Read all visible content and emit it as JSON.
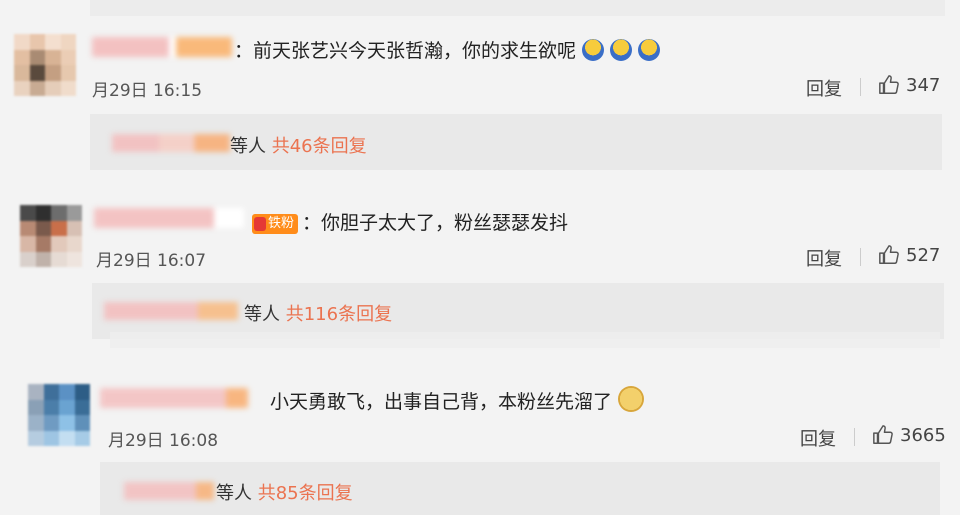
{
  "comments": [
    {
      "text": "：前天张艺兴今天张哲瀚，你的求生欲呢",
      "emoji": "sad-emoji-icon",
      "timestamp": "月29日 16:15",
      "reply_label": "回复",
      "likes": "347",
      "sub": {
        "suffix": "等人",
        "count": "共46条回复"
      }
    },
    {
      "badge": "铁粉",
      "text": "：你胆子太大了，粉丝瑟瑟发抖",
      "timestamp": "月29日 16:07",
      "reply_label": "回复",
      "likes": "527",
      "sub": {
        "suffix": "等人",
        "count": "共116条回复"
      }
    },
    {
      "text": "小天勇敢飞，出事自己背，本粉丝先溜了",
      "emoji": "dog-emoji-icon",
      "timestamp": "月29日 16:08",
      "reply_label": "回复",
      "likes": "3665",
      "sub": {
        "suffix": "等人",
        "count": "共85条回复"
      }
    }
  ],
  "colors": {
    "background": "#f3f3f3",
    "link_orange": "#eb7350",
    "badge_orange": "#ff8c1a"
  }
}
